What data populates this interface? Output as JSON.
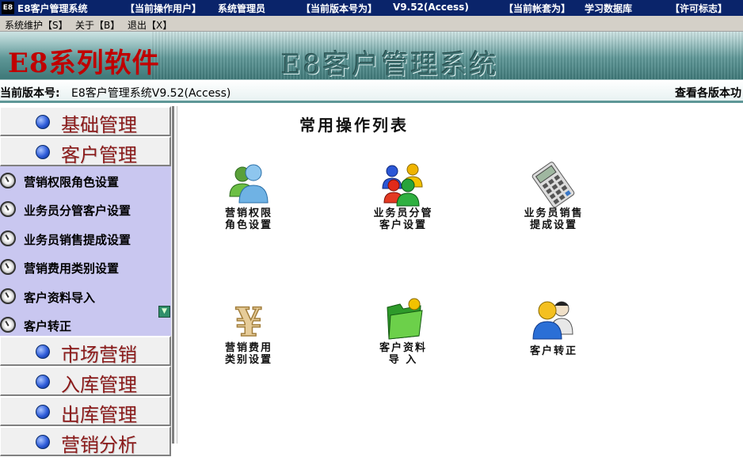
{
  "titlebar": {
    "app_icon": "E8",
    "app_title": "E8客户管理系统",
    "user_label": "【当前操作用户】",
    "user_value": "系统管理员",
    "version_label": "【当前版本号为】",
    "version_value": "V9.52(Access)",
    "account_label": "【当前帐套为】",
    "account_value": "学习数据库",
    "license_label": "【许可标志】"
  },
  "menubar": {
    "items": [
      "系统维护【S】",
      "关于【B】",
      "退出【X】"
    ]
  },
  "banner": {
    "brand": "E8系列软件",
    "system_name": "E8客户管理系统"
  },
  "versionbar": {
    "label": "当前版本号:",
    "value": "E8客户管理系统V9.52(Access)",
    "link": "查看各版本功"
  },
  "sidebar": {
    "categories_top": [
      "基础管理",
      "客户管理"
    ],
    "sub_items": [
      "营销权限角色设置",
      "业务员分管客户设置",
      "业务员销售提成设置",
      "营销费用类别设置",
      "客户资料导入",
      "客户转正"
    ],
    "categories_bottom": [
      "市场营销",
      "入库管理",
      "出库管理",
      "营销分析"
    ]
  },
  "main": {
    "title": "常用操作列表",
    "operations": [
      {
        "label": "营销权限\n角色设置",
        "icon": "two-users-icon"
      },
      {
        "label": "业务员分管\n客户设置",
        "icon": "user-group-icon"
      },
      {
        "label": "业务员销售\n提成设置",
        "icon": "calculator-icon"
      },
      {
        "label": "营销费用\n类别设置",
        "icon": "yen-icon"
      },
      {
        "label": "客户资料\n导  入",
        "icon": "folder-icon"
      },
      {
        "label": "客户转正",
        "icon": "user-promote-icon"
      }
    ]
  },
  "colors": {
    "titlebar_bg": "#0a246a",
    "banner_brand": "#c00000",
    "category_text": "#8b1a1a",
    "subpanel_bg": "#c9c7f0"
  }
}
